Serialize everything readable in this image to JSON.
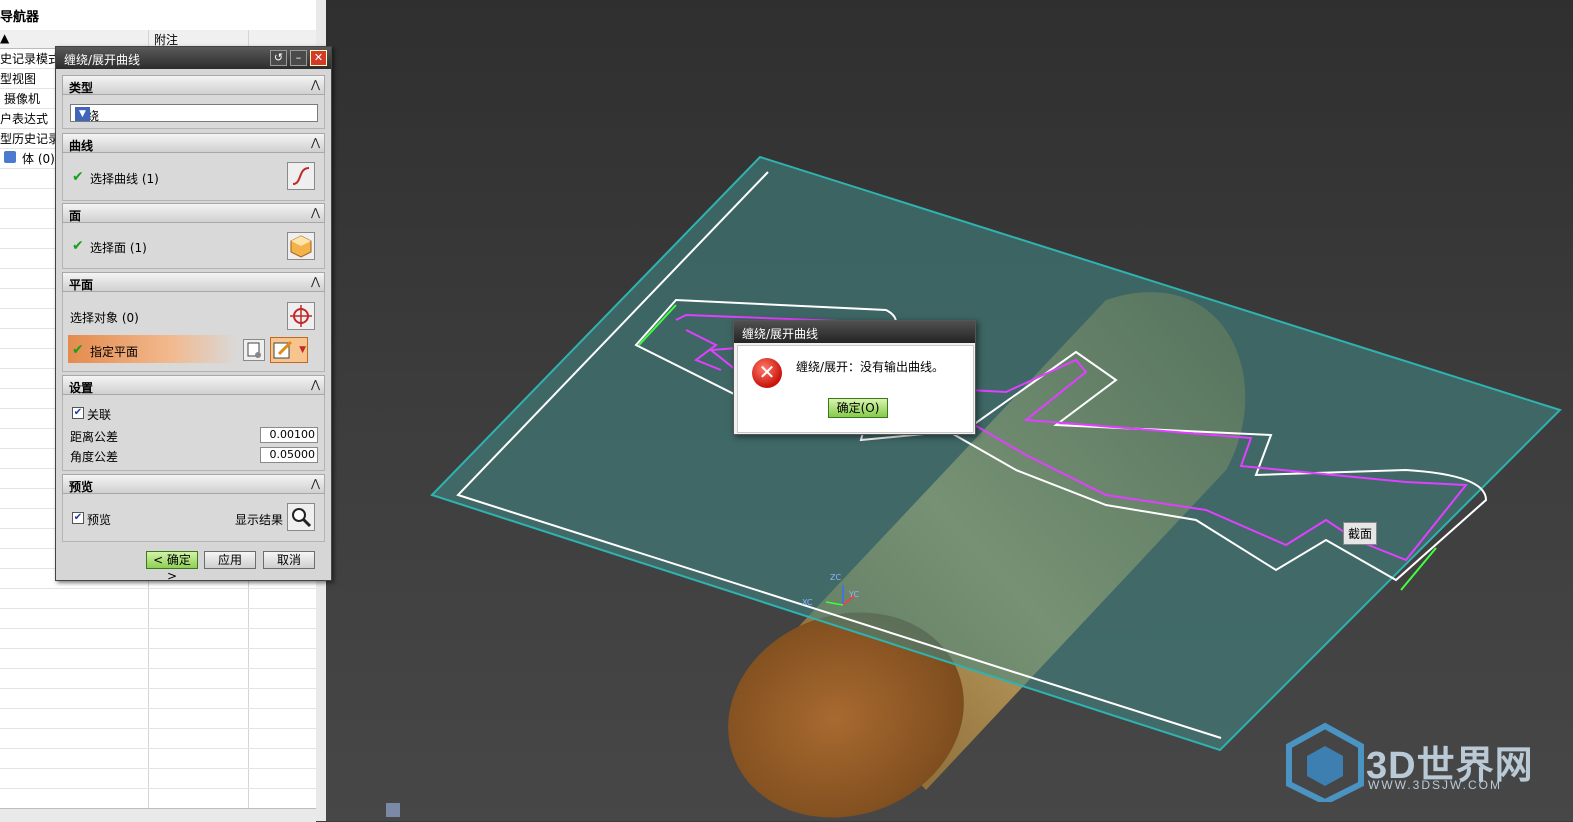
{
  "navigator": {
    "title": "导航器",
    "col_notes": "附注",
    "rows": [
      "史记录模式",
      "型视图",
      "摄像机",
      "户表达式",
      "型历史记录",
      "体 (0)"
    ]
  },
  "dialog": {
    "title": "缠绕/展开曲线",
    "type_header": "类型",
    "type_value": "缠绕",
    "curve_header": "曲线",
    "select_curve": "选择曲线 (1)",
    "face_header": "面",
    "select_face": "选择面 (1)",
    "plane_header": "平面",
    "select_object": "选择对象 (0)",
    "specify_plane": "指定平面",
    "settings_header": "设置",
    "associative": "关联",
    "distance_tol_label": "距离公差",
    "distance_tol_value": "0.00100",
    "angle_tol_label": "角度公差",
    "angle_tol_value": "0.05000",
    "preview_header": "预览",
    "preview": "预览",
    "show_result": "显示结果",
    "ok": "< 确定 >",
    "apply": "应用",
    "cancel": "取消"
  },
  "message_box": {
    "title": "缠绕/展开曲线",
    "text": "缠绕/展开：没有输出曲线。",
    "ok": "确定(O)"
  },
  "viewport": {
    "section_label": "截面",
    "axis_zc": "ZC",
    "axis_yc": "YC",
    "axis_xc": "XC"
  },
  "watermark": {
    "brand": "3D世界网",
    "url": "WWW.3DSJW.COM"
  },
  "colors": {
    "plane_fill": "#3f8a86",
    "plane_edge": "#2fb3b0",
    "cylinder": "#b58a4a",
    "curve": "#e040ff",
    "offset_curve": "#ffffff"
  }
}
